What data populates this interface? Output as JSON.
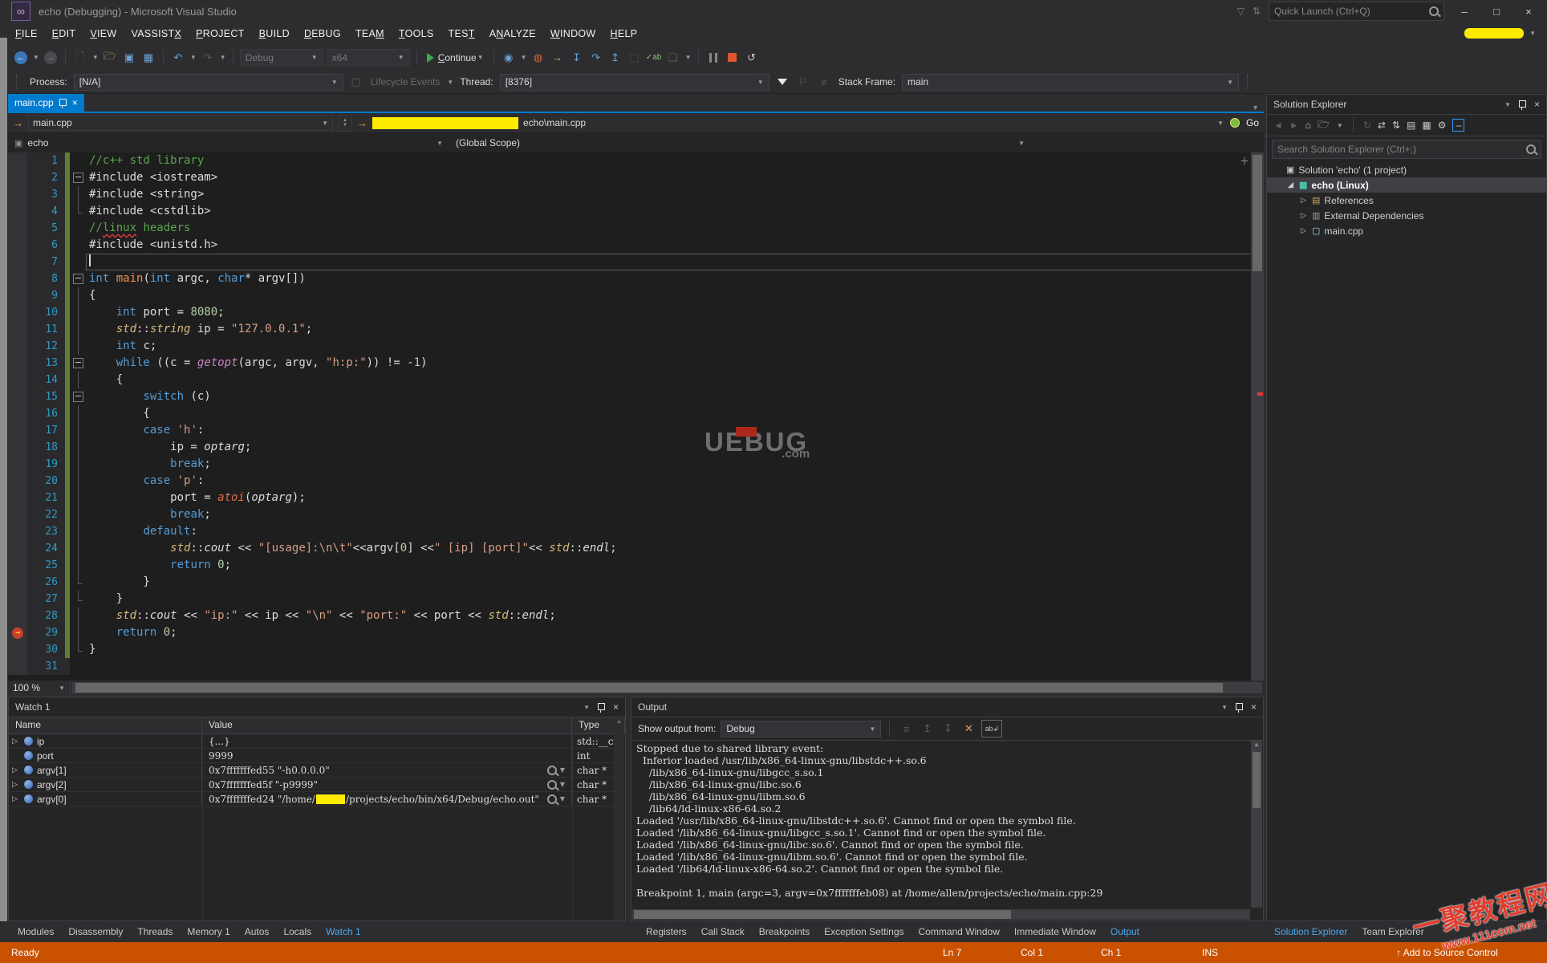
{
  "window": {
    "title": "echo (Debugging) - Microsoft Visual Studio",
    "quick_launch_placeholder": "Quick Launch (Ctrl+Q)",
    "minimize": "–",
    "maximize": "□",
    "close": "×"
  },
  "menu": {
    "items": [
      {
        "label": "FILE",
        "u": 0
      },
      {
        "label": "EDIT",
        "u": 0
      },
      {
        "label": "VIEW",
        "u": 0
      },
      {
        "label": "VASSISTX",
        "u": 7
      },
      {
        "label": "PROJECT",
        "u": 0
      },
      {
        "label": "BUILD",
        "u": 0
      },
      {
        "label": "DEBUG",
        "u": 0
      },
      {
        "label": "TEAM",
        "u": 3
      },
      {
        "label": "TOOLS",
        "u": 0
      },
      {
        "label": "TEST",
        "u": 3
      },
      {
        "label": "ANALYZE",
        "u": 1
      },
      {
        "label": "WINDOW",
        "u": 0
      },
      {
        "label": "HELP",
        "u": 0
      }
    ]
  },
  "toolbar": {
    "debug_config": "Debug",
    "platform": "x64",
    "continue_label": "Continue"
  },
  "debug_location": {
    "process_label": "Process:",
    "process_value": "[N/A]",
    "lifecycle_label": "Lifecycle Events",
    "thread_label": "Thread:",
    "thread_value": "[8376]",
    "stack_frame_label": "Stack Frame:",
    "stack_frame_value": "main"
  },
  "editor": {
    "tab": "main.cpp",
    "breadcrumb_file": "main.cpp",
    "breadcrumb_path_suffix": "echo\\main.cpp",
    "go_label": "Go",
    "nav_context": "echo",
    "nav_scope": "(Global Scope)",
    "zoom": "100 %",
    "watermark_main": "UEBUG",
    "watermark_suffix": ".com",
    "lines": [
      {
        "n": 1,
        "t": [
          [
            "cm",
            "//c++ std library"
          ]
        ]
      },
      {
        "n": 2,
        "fold": "box",
        "t": [
          [
            "pl",
            "#include <iostream>"
          ]
        ]
      },
      {
        "n": 3,
        "fold": "line",
        "t": [
          [
            "pl",
            "#include <string>"
          ]
        ]
      },
      {
        "n": 4,
        "fold": "end",
        "t": [
          [
            "pl",
            "#include <cstdlib>"
          ]
        ]
      },
      {
        "n": 5,
        "t": [
          [
            "cm",
            "//"
          ],
          [
            "cmsq",
            "linux"
          ],
          [
            "cm",
            " headers"
          ]
        ]
      },
      {
        "n": 6,
        "t": [
          [
            "pl",
            "#include <unistd.h>"
          ]
        ]
      },
      {
        "n": 7,
        "cur": true,
        "t": []
      },
      {
        "n": 8,
        "fold": "box",
        "t": [
          [
            "kw",
            "int "
          ],
          [
            "fn",
            "main"
          ],
          [
            "pl",
            "("
          ],
          [
            "kw",
            "int"
          ],
          [
            "pl",
            " argc, "
          ],
          [
            "kw",
            "char"
          ],
          [
            "pl",
            "* argv[])"
          ]
        ]
      },
      {
        "n": 9,
        "fold": "line",
        "t": [
          [
            "pl",
            "{"
          ]
        ]
      },
      {
        "n": 10,
        "fold": "line",
        "t": [
          [
            "pl",
            "    "
          ],
          [
            "kw",
            "int"
          ],
          [
            "pl",
            " port = "
          ],
          [
            "nm",
            "8080"
          ],
          [
            "pl",
            ";"
          ]
        ]
      },
      {
        "n": 11,
        "fold": "line",
        "t": [
          [
            "pl",
            "    "
          ],
          [
            "ty",
            "std"
          ],
          [
            "pl",
            "::"
          ],
          [
            "ty",
            "string"
          ],
          [
            "pl",
            " ip = "
          ],
          [
            "st",
            "\"127.0.0.1\""
          ],
          [
            "pl",
            ";"
          ]
        ]
      },
      {
        "n": 12,
        "fold": "line",
        "t": [
          [
            "pl",
            "    "
          ],
          [
            "kw",
            "int"
          ],
          [
            "pl",
            " c;"
          ]
        ]
      },
      {
        "n": 13,
        "fold": "box",
        "t": [
          [
            "pl",
            "    "
          ],
          [
            "kw",
            "while"
          ],
          [
            "pl",
            " ((c = "
          ],
          [
            "mg",
            "getopt"
          ],
          [
            "pl",
            "(argc, argv, "
          ],
          [
            "st",
            "\"h:p:\""
          ],
          [
            "pl",
            ")) != -"
          ],
          [
            "nm",
            "1"
          ],
          [
            "pl",
            ")"
          ]
        ]
      },
      {
        "n": 14,
        "fold": "line",
        "t": [
          [
            "pl",
            "    {"
          ]
        ]
      },
      {
        "n": 15,
        "fold": "box",
        "t": [
          [
            "pl",
            "        "
          ],
          [
            "kw",
            "switch"
          ],
          [
            "pl",
            " (c)"
          ]
        ]
      },
      {
        "n": 16,
        "fold": "line",
        "t": [
          [
            "pl",
            "        {"
          ]
        ]
      },
      {
        "n": 17,
        "fold": "line",
        "t": [
          [
            "pl",
            "        "
          ],
          [
            "kw",
            "case"
          ],
          [
            "pl",
            " "
          ],
          [
            "st",
            "'h'"
          ],
          [
            "pl",
            ":"
          ]
        ]
      },
      {
        "n": 18,
        "fold": "line",
        "t": [
          [
            "pl",
            "            ip = "
          ],
          [
            "it",
            "optarg"
          ],
          [
            "pl",
            ";"
          ]
        ]
      },
      {
        "n": 19,
        "fold": "line",
        "t": [
          [
            "pl",
            "            "
          ],
          [
            "kw",
            "break"
          ],
          [
            "pl",
            ";"
          ]
        ]
      },
      {
        "n": 20,
        "fold": "line",
        "t": [
          [
            "pl",
            "        "
          ],
          [
            "kw",
            "case"
          ],
          [
            "pl",
            " "
          ],
          [
            "st",
            "'p'"
          ],
          [
            "pl",
            ":"
          ]
        ]
      },
      {
        "n": 21,
        "fold": "line",
        "t": [
          [
            "pl",
            "            port = "
          ],
          [
            "fni",
            "atoi"
          ],
          [
            "pl",
            "("
          ],
          [
            "it",
            "optarg"
          ],
          [
            "pl",
            ");"
          ]
        ]
      },
      {
        "n": 22,
        "fold": "line",
        "t": [
          [
            "pl",
            "            "
          ],
          [
            "kw",
            "break"
          ],
          [
            "pl",
            ";"
          ]
        ]
      },
      {
        "n": 23,
        "fold": "line",
        "t": [
          [
            "pl",
            "        "
          ],
          [
            "kw",
            "default"
          ],
          [
            "pl",
            ":"
          ]
        ]
      },
      {
        "n": 24,
        "fold": "line",
        "t": [
          [
            "pl",
            "            "
          ],
          [
            "ty",
            "std"
          ],
          [
            "pl",
            "::"
          ],
          [
            "it",
            "cout"
          ],
          [
            "pl",
            " << "
          ],
          [
            "st",
            "\"[usage]:\\n\\t\""
          ],
          [
            "pl",
            "<<argv["
          ],
          [
            "nm",
            "0"
          ],
          [
            "pl",
            "] <<"
          ],
          [
            "st",
            "\" [ip] [port]\""
          ],
          [
            "pl",
            "<< "
          ],
          [
            "ty",
            "std"
          ],
          [
            "pl",
            "::"
          ],
          [
            "it",
            "endl"
          ],
          [
            "pl",
            ";"
          ]
        ]
      },
      {
        "n": 25,
        "fold": "line",
        "t": [
          [
            "pl",
            "            "
          ],
          [
            "kw",
            "return"
          ],
          [
            "pl",
            " "
          ],
          [
            "nm",
            "0"
          ],
          [
            "pl",
            ";"
          ]
        ]
      },
      {
        "n": 26,
        "fold": "end",
        "t": [
          [
            "pl",
            "        }"
          ]
        ]
      },
      {
        "n": 27,
        "fold": "end",
        "t": [
          [
            "pl",
            "    }"
          ]
        ]
      },
      {
        "n": 28,
        "fold": "line",
        "t": [
          [
            "pl",
            "    "
          ],
          [
            "ty",
            "std"
          ],
          [
            "pl",
            "::"
          ],
          [
            "it",
            "cout"
          ],
          [
            "pl",
            " << "
          ],
          [
            "st",
            "\"ip:\""
          ],
          [
            "pl",
            " << ip << "
          ],
          [
            "st",
            "\"\\n\""
          ],
          [
            "pl",
            " << "
          ],
          [
            "st",
            "\"port:\""
          ],
          [
            "pl",
            " << port << "
          ],
          [
            "ty",
            "std"
          ],
          [
            "pl",
            "::"
          ],
          [
            "it",
            "endl"
          ],
          [
            "pl",
            ";"
          ]
        ]
      },
      {
        "n": 29,
        "bp": true,
        "fold": "line",
        "t": [
          [
            "pl",
            "    "
          ],
          [
            "kw",
            "return"
          ],
          [
            "pl",
            " "
          ],
          [
            "nm",
            "0"
          ],
          [
            "pl",
            ";"
          ]
        ]
      },
      {
        "n": 30,
        "fold": "end",
        "t": [
          [
            "pl",
            "}"
          ]
        ]
      },
      {
        "n": 31,
        "t": []
      }
    ]
  },
  "watch": {
    "title": "Watch 1",
    "columns": [
      "Name",
      "Value",
      "Type"
    ],
    "rows": [
      {
        "expand": true,
        "name": "ip",
        "parts": [
          {
            "text": "{...}"
          }
        ],
        "mag": false,
        "type": "std::__cx"
      },
      {
        "expand": false,
        "name": "port",
        "parts": [
          {
            "text": "9999"
          }
        ],
        "mag": false,
        "type": "int"
      },
      {
        "expand": true,
        "name": "argv[1]",
        "parts": [
          {
            "text": "0x7fffffffed55 \"-h0.0.0.0\""
          }
        ],
        "mag": true,
        "type": "char *"
      },
      {
        "expand": true,
        "name": "argv[2]",
        "parts": [
          {
            "text": "0x7fffffffed5f \"-p9999\""
          }
        ],
        "mag": true,
        "type": "char *"
      },
      {
        "expand": true,
        "name": "argv[0]",
        "parts": [
          {
            "text": "0x7fffffffed24 \"/home/"
          },
          {
            "redact": 36
          },
          {
            "text": "/projects/echo/bin/x64/Debug/echo.out\""
          }
        ],
        "mag": true,
        "type": "char *"
      }
    ]
  },
  "output": {
    "title": "Output",
    "show_output_from_label": "Show output from:",
    "source": "Debug",
    "lines": [
      "Stopped due to shared library event:",
      "  Inferior loaded /usr/lib/x86_64-linux-gnu/libstdc++.so.6",
      "    /lib/x86_64-linux-gnu/libgcc_s.so.1",
      "    /lib/x86_64-linux-gnu/libc.so.6",
      "    /lib/x86_64-linux-gnu/libm.so.6",
      "    /lib64/ld-linux-x86-64.so.2",
      "Loaded '/usr/lib/x86_64-linux-gnu/libstdc++.so.6'. Cannot find or open the symbol file.",
      "Loaded '/lib/x86_64-linux-gnu/libgcc_s.so.1'. Cannot find or open the symbol file.",
      "Loaded '/lib/x86_64-linux-gnu/libc.so.6'. Cannot find or open the symbol file.",
      "Loaded '/lib/x86_64-linux-gnu/libm.so.6'. Cannot find or open the symbol file.",
      "Loaded '/lib64/ld-linux-x86-64.so.2'. Cannot find or open the symbol file.",
      "",
      "Breakpoint 1, main (argc=3, argv=0x7fffffffeb08) at /home/allen/projects/echo/main.cpp:29"
    ]
  },
  "solution_explorer": {
    "title": "Solution Explorer",
    "search_placeholder": "Search Solution Explorer (Ctrl+;)",
    "tree": [
      {
        "label": "Solution 'echo' (1 project)",
        "indent": 0,
        "arrow": "",
        "icon": "solution"
      },
      {
        "label": "echo (Linux)",
        "indent": 1,
        "arrow": "exp",
        "icon": "project",
        "selected": true
      },
      {
        "label": "References",
        "indent": 2,
        "arrow": "col",
        "icon": "references"
      },
      {
        "label": "External Dependencies",
        "indent": 2,
        "arrow": "col",
        "icon": "deps"
      },
      {
        "label": "main.cpp",
        "indent": 2,
        "arrow": "col",
        "icon": "cpp"
      }
    ]
  },
  "bottom_tabs": {
    "left": [
      "Modules",
      "Disassembly",
      "Threads",
      "Memory 1",
      "Autos",
      "Locals",
      "Watch 1"
    ],
    "left_active": "Watch 1",
    "center": [
      "Registers",
      "Call Stack",
      "Breakpoints",
      "Exception Settings",
      "Command Window",
      "Immediate Window",
      "Output"
    ],
    "center_active": "Output",
    "right": [
      "Solution Explorer",
      "Team Explorer"
    ],
    "right_active": "Solution Explorer"
  },
  "status_bar": {
    "left": "Ready",
    "ln": "Ln 7",
    "col": "Col 1",
    "ch": "Ch 1",
    "ins": "INS",
    "source_control": "Add to Source Control"
  },
  "watermark": {
    "line1": "一聚教程网",
    "line2": "www.111com.net"
  },
  "colors": {
    "accent": "#007ACC",
    "status_debug": "#CA5100",
    "redaction": "#FFEB00"
  }
}
